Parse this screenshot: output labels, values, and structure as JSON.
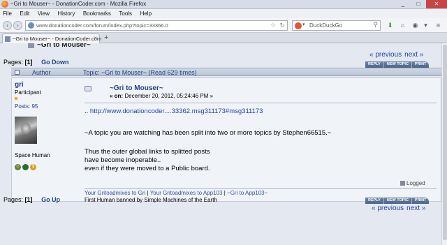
{
  "window": {
    "title": "~Gri to Mouser~ - DonationCoder.com - Mozilla Firefox",
    "min": "_",
    "max": "□",
    "close": "✕"
  },
  "menu": [
    "File",
    "Edit",
    "View",
    "History",
    "Bookmarks",
    "Tools",
    "Help"
  ],
  "nav": {
    "url": "www.donationcoder.com/forum/index.php?topic=33366.0",
    "search_engine": "DuckDuckGo"
  },
  "tab": {
    "label": "~Gri to Mouser~ - DonationCoder.com",
    "close": "×",
    "new": "+"
  },
  "page": {
    "top_cut_title": "~Gri to Mouser~",
    "prev_label": "« previous",
    "next_label": "next »",
    "pages_label": "Pages:",
    "current_page": "[1]",
    "go_down": "Go Down",
    "go_up": "Go Up",
    "buttons": [
      "REPLY",
      "NEW TOPIC",
      "PRINT"
    ],
    "header_author": "Author",
    "header_topic": "Topic: ~Gri to Mouser~  (Read 629 times)"
  },
  "post": {
    "author": "gri",
    "role": "Participant",
    "posts": "Posts: 95",
    "personal_text": "Space Human",
    "subject": "~Gri to Mouser~",
    "date_prefix": "« on:",
    "date": "December 20, 2012, 05:24:46 PM »",
    "link_prefix": "..",
    "link": "http://www.donationcoder....33362.msg311173#msg311173",
    "line1": "~A topic you are watching has been split into two or more topics by Stephen66515.~",
    "line2": "Thus the outer global links to splitted posts",
    "line3": "have become inoperable..",
    "line4": "even if they were moved to a Public board.",
    "logged": "Logged",
    "sig_link1": "Your Gritoadmixes to Gri",
    "sig_sep": "|",
    "sig_link2": "Your Gritoadmixes to App103",
    "sig_link3": "~Gri to App103~",
    "sig_line2": "First Human banned by Simple Machines of the Earth"
  }
}
